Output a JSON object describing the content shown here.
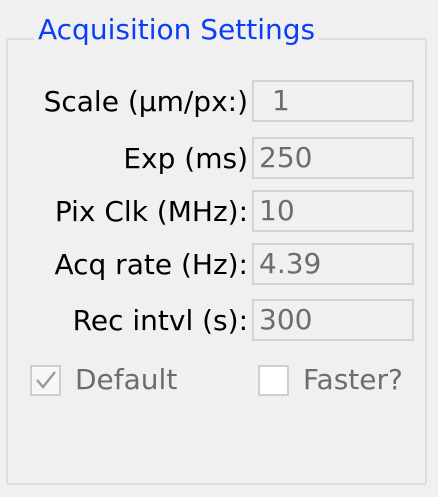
{
  "group": {
    "title": "Acquisition Settings"
  },
  "rows": [
    {
      "label": "Scale (µm/px:)",
      "value": "1"
    },
    {
      "label": "Exp (ms)",
      "value": "250"
    },
    {
      "label": "Pix Clk (MHz):",
      "value": "10"
    },
    {
      "label": "Acq rate (Hz):",
      "value": "4.39"
    },
    {
      "label": "Rec intvl (s):",
      "value": "300"
    }
  ],
  "checkboxes": {
    "default": {
      "label": "Default",
      "checked": true,
      "enabled": false
    },
    "faster": {
      "label": "Faster?",
      "checked": false,
      "enabled": true
    }
  },
  "colors": {
    "title": "#0a3ff5",
    "disabled_text": "#6d6d6d",
    "background": "#f0f0f0"
  }
}
